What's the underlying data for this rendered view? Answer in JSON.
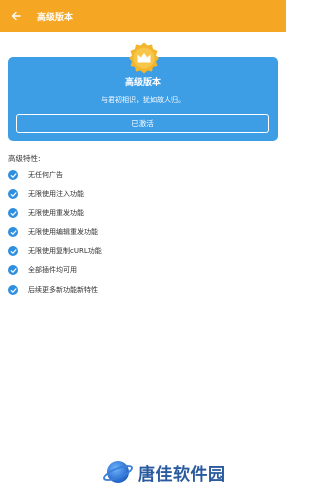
{
  "appbar": {
    "title": "高级版本",
    "back_icon": "arrow-left-icon",
    "color": "#f5a623"
  },
  "card": {
    "title": "高级版本",
    "subtitle": "与君初相识，犹如故人归。",
    "button_label": "已激活",
    "badge_icon": "crown-icon",
    "color": "#3d9ee6"
  },
  "features": {
    "heading": "高级特性:",
    "items": [
      "无任何广告",
      "无限使用注入功能",
      "无限使用重发功能",
      "无限使用编辑重发功能",
      "无限使用复制cURL功能",
      "全部插件均可用",
      "后续更多新功能新特性"
    ]
  },
  "watermark": {
    "text": "唐佳软件园"
  }
}
